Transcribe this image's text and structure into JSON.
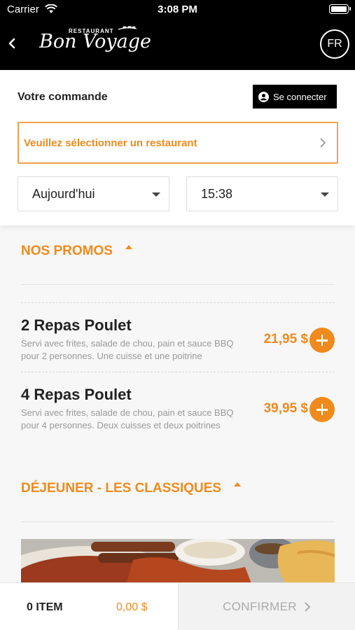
{
  "status_bar": {
    "carrier": "Carrier",
    "time": "3:08 PM"
  },
  "header": {
    "logo_small": "RESTAURANT",
    "logo_script": "Bon Voyage",
    "language": "FR"
  },
  "order": {
    "title": "Votre commande",
    "login_label": "Se connecter",
    "restaurant_placeholder": "Veuillez sélectionner un restaurant",
    "date_value": "Aujourd'hui",
    "time_value": "15:38"
  },
  "sections": [
    {
      "title": "NOS PROMOS",
      "items": [
        {
          "name": "2 Repas Poulet",
          "description": "Servi avec frites, salade de chou, pain et sauce BBQ pour 2 personnes. Une cuisse et une poitrine",
          "price": "21,95 $"
        },
        {
          "name": "4 Repas Poulet",
          "description": "Servi avec frites, salade de chou, pain et sauce BBQ pour 4 personnes. Deux cuisses et deux poitrines",
          "price": "39,95 $"
        }
      ]
    },
    {
      "title": "DÉJEUNER - LES CLASSIQUES"
    }
  ],
  "cart": {
    "count": "0 ITEM",
    "total": "0,00 $",
    "confirm_label": "CONFIRMER"
  },
  "colors": {
    "accent": "#f08a1c",
    "header_bg": "#000000"
  },
  "icons": [
    "wifi-icon",
    "battery-icon",
    "back-chevron-icon",
    "user-circle-icon",
    "chevron-right-icon",
    "caret-down-icon",
    "caret-up-icon",
    "plus-icon"
  ]
}
